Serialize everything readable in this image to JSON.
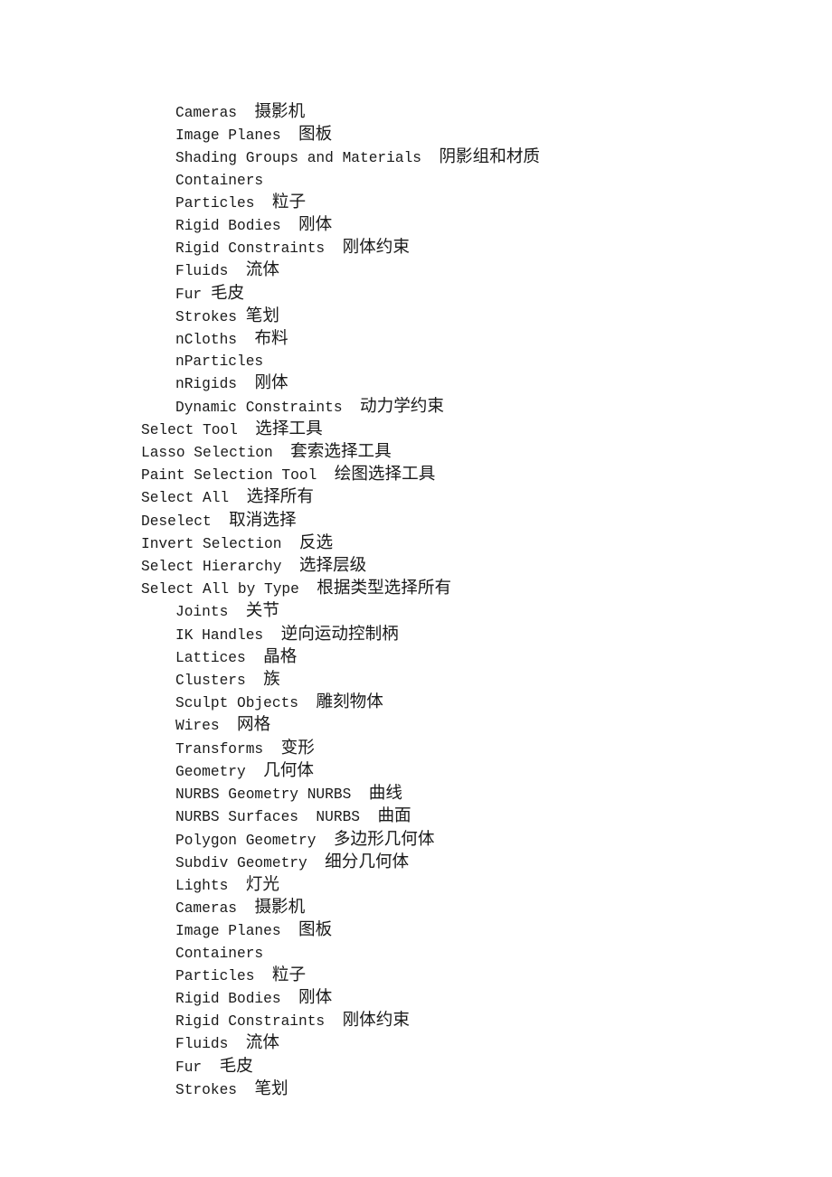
{
  "document": {
    "title": "Maya Menu Bilingual Reference",
    "background_color": "#ffffff",
    "text_color": "#1a1a1a",
    "lines": [
      {
        "indent": 1,
        "en": "Cameras",
        "gap": "  ",
        "zh": "摄影机"
      },
      {
        "indent": 1,
        "en": "Image Planes",
        "gap": "  ",
        "zh": "图板"
      },
      {
        "indent": 1,
        "en": "Shading Groups and Materials",
        "gap": "  ",
        "zh": "阴影组和材质"
      },
      {
        "indent": 1,
        "en": "Containers",
        "gap": "",
        "zh": ""
      },
      {
        "indent": 1,
        "en": "Particles",
        "gap": "  ",
        "zh": "粒子"
      },
      {
        "indent": 1,
        "en": "Rigid Bodies",
        "gap": "  ",
        "zh": "刚体"
      },
      {
        "indent": 1,
        "en": "Rigid Constraints",
        "gap": "  ",
        "zh": "刚体约束"
      },
      {
        "indent": 1,
        "en": "Fluids",
        "gap": "  ",
        "zh": "流体"
      },
      {
        "indent": 1,
        "en": "Fur",
        "gap": " ",
        "zh": "毛皮"
      },
      {
        "indent": 1,
        "en": "Strokes",
        "gap": " ",
        "zh": "笔划"
      },
      {
        "indent": 1,
        "en": "nCloths",
        "gap": "  ",
        "zh": "布料"
      },
      {
        "indent": 1,
        "en": "nParticles",
        "gap": "",
        "zh": ""
      },
      {
        "indent": 1,
        "en": "nRigids",
        "gap": "  ",
        "zh": "刚体"
      },
      {
        "indent": 1,
        "en": "Dynamic Constraints",
        "gap": "  ",
        "zh": "动力学约束"
      },
      {
        "indent": 0,
        "en": "Select Tool",
        "gap": "  ",
        "zh": "选择工具"
      },
      {
        "indent": 0,
        "en": "Lasso Selection",
        "gap": "  ",
        "zh": "套索选择工具"
      },
      {
        "indent": 0,
        "en": "Paint Selection Tool",
        "gap": "  ",
        "zh": "绘图选择工具"
      },
      {
        "indent": 0,
        "en": "Select All",
        "gap": "  ",
        "zh": "选择所有"
      },
      {
        "indent": 0,
        "en": "Deselect",
        "gap": "  ",
        "zh": "取消选择"
      },
      {
        "indent": 0,
        "en": "Invert Selection",
        "gap": "  ",
        "zh": "反选"
      },
      {
        "indent": 0,
        "en": "Select Hierarchy",
        "gap": "  ",
        "zh": "选择层级"
      },
      {
        "indent": 0,
        "en": "Select All by Type",
        "gap": "  ",
        "zh": "根据类型选择所有"
      },
      {
        "indent": 1,
        "en": "Joints",
        "gap": "  ",
        "zh": "关节"
      },
      {
        "indent": 1,
        "en": "IK Handles",
        "gap": "  ",
        "zh": "逆向运动控制柄"
      },
      {
        "indent": 1,
        "en": "Lattices",
        "gap": "  ",
        "zh": "晶格"
      },
      {
        "indent": 1,
        "en": "Clusters",
        "gap": "  ",
        "zh": "族"
      },
      {
        "indent": 1,
        "en": "Sculpt Objects",
        "gap": "  ",
        "zh": "雕刻物体"
      },
      {
        "indent": 1,
        "en": "Wires",
        "gap": "  ",
        "zh": "网格"
      },
      {
        "indent": 1,
        "en": "Transforms",
        "gap": "  ",
        "zh": "变形"
      },
      {
        "indent": 1,
        "en": "Geometry",
        "gap": "  ",
        "zh": "几何体"
      },
      {
        "indent": 1,
        "en": "NURBS Geometry NURBS",
        "gap": "  ",
        "zh": "曲线"
      },
      {
        "indent": 1,
        "en": "NURBS Surfaces  NURBS",
        "gap": "  ",
        "zh": "曲面"
      },
      {
        "indent": 1,
        "en": "Polygon Geometry",
        "gap": "  ",
        "zh": "多边形几何体"
      },
      {
        "indent": 1,
        "en": "Subdiv Geometry",
        "gap": "  ",
        "zh": "细分几何体"
      },
      {
        "indent": 1,
        "en": "Lights",
        "gap": "  ",
        "zh": "灯光"
      },
      {
        "indent": 1,
        "en": "Cameras",
        "gap": "  ",
        "zh": "摄影机"
      },
      {
        "indent": 1,
        "en": "Image Planes",
        "gap": "  ",
        "zh": "图板"
      },
      {
        "indent": 1,
        "en": "Containers",
        "gap": "",
        "zh": ""
      },
      {
        "indent": 1,
        "en": "Particles",
        "gap": "  ",
        "zh": "粒子"
      },
      {
        "indent": 1,
        "en": "Rigid Bodies",
        "gap": "  ",
        "zh": "刚体"
      },
      {
        "indent": 1,
        "en": "Rigid Constraints",
        "gap": "  ",
        "zh": "刚体约束"
      },
      {
        "indent": 1,
        "en": "Fluids",
        "gap": "  ",
        "zh": "流体"
      },
      {
        "indent": 1,
        "en": "Fur",
        "gap": "  ",
        "zh": "毛皮"
      },
      {
        "indent": 1,
        "en": "Strokes",
        "gap": "  ",
        "zh": "笔划"
      }
    ]
  }
}
